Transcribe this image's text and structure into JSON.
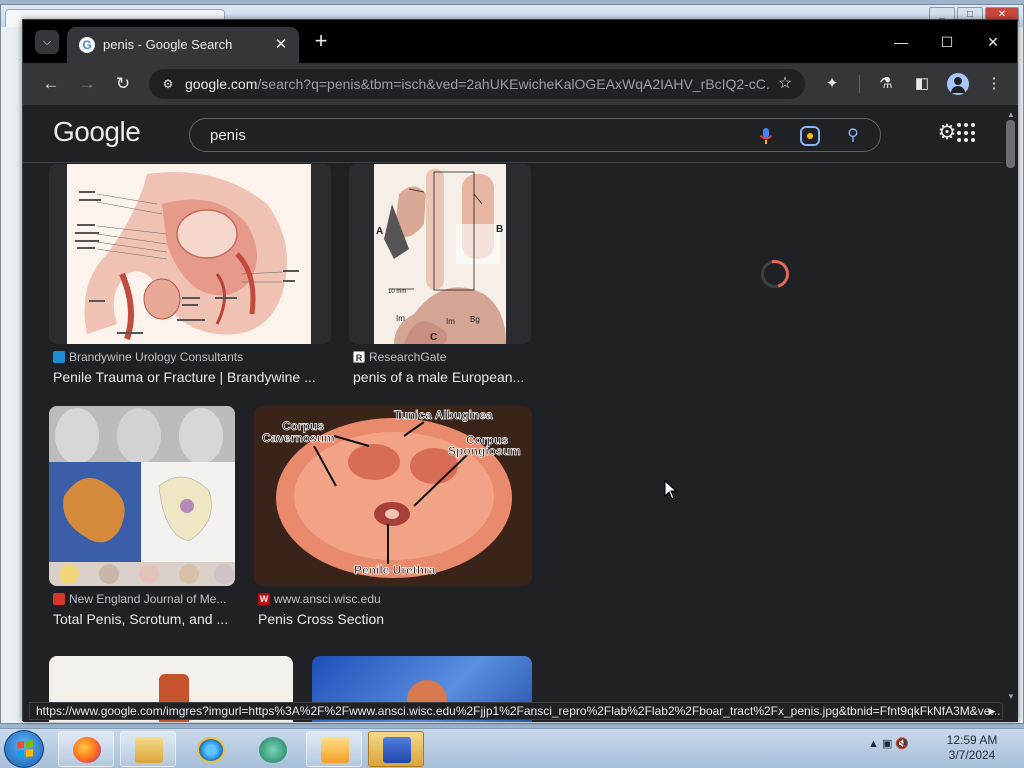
{
  "browser": {
    "tab_title": "penis - Google Search",
    "tab_close": "✕",
    "new_tab": "+",
    "window_controls": {
      "minimize": "—",
      "maximize": "☐",
      "close": "✕"
    },
    "url_host": "google.com",
    "url_rest": "/search?q=penis&tbm=isch&ved=2ahUKEwicheKalOGEAxWqA2IAHV_rBcIQ2-cC..."
  },
  "google": {
    "logo": "Google",
    "query": "penis"
  },
  "results": [
    {
      "source": "Brandywine Urology Consultants",
      "title": "Penile Trauma or Fracture | Brandywine ...",
      "favicon_color": "#1f8ad6",
      "favicon_letter": ""
    },
    {
      "source": "ResearchGate",
      "title": "penis of a male European...",
      "favicon_color": "#ffffff",
      "favicon_letter": "R"
    },
    {
      "source": "New England Journal of Me...",
      "title": "Total Penis, Scrotum, and ...",
      "favicon_color": "#d9352a",
      "favicon_letter": ""
    },
    {
      "source": "www.ansci.wisc.edu",
      "title": "Penis Cross Section",
      "favicon_color": "#c5050c",
      "favicon_letter": "W"
    }
  ],
  "image_labels": {
    "corpus_cavernosum": "Corpus\nCavernosum",
    "tunica_albuginea": "Tunica Albuginea",
    "corpus_spongiosum": "Corpus\nSpongiosum",
    "penile_urethra": "Penile Urethra",
    "scale_bar": "10 mm",
    "letter_a": "A",
    "letter_b": "B",
    "letter_c": "C",
    "label_im": "Im",
    "label_im2": "Im",
    "label_bg": "Bg"
  },
  "status_url": "https://www.google.com/imgres?imgurl=https%3A%2F%2Fwww.ansci.wisc.edu%2Fjjp1%2Fansci_repro%2Flab%2Flab2%2Fboar_tract%2Fx_penis.jpg&tbnid=Ffnt9qkFkNfA3M&ve...",
  "taskbar": {
    "time": "12:59 AM",
    "date": "3/7/2024"
  },
  "colors": {
    "page_bg": "#202124",
    "text": "#e8eaed",
    "muted": "#bdc1c6",
    "accent": "#8ab4f8",
    "spinner": "#e36a5a"
  }
}
